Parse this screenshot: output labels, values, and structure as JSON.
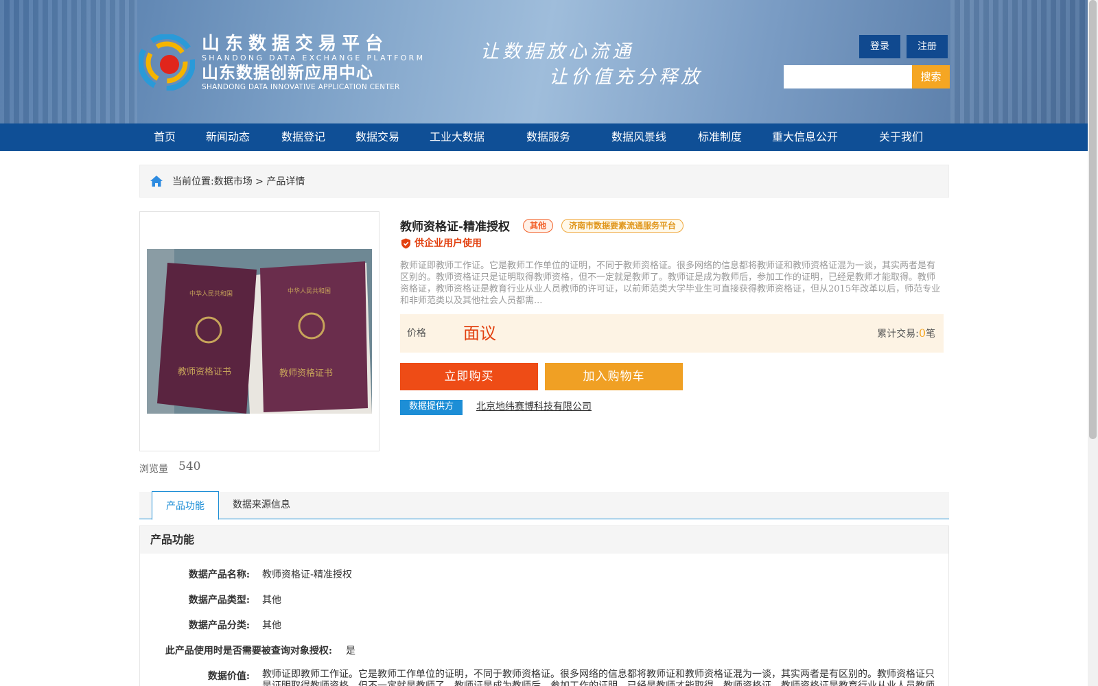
{
  "header": {
    "logo_cn_1": "山东数据交易平台",
    "logo_en_1": "SHANDONG DATA EXCHANGE PLATFORM",
    "logo_cn_2": "山东数据创新应用中心",
    "logo_en_2": "SHANDONG DATA INNOVATIVE APPLICATION CENTER",
    "slogan_1": "让数据放心流通",
    "slogan_2": "让价值充分释放",
    "login_label": "登录",
    "register_label": "注册",
    "search_value": "",
    "search_label": "搜索"
  },
  "nav": {
    "items": [
      "首页",
      "新闻动态",
      "数据登记",
      "数据交易",
      "工业大数据",
      "数据服务",
      "数据风景线",
      "标准制度",
      "重大信息公开",
      "关于我们"
    ]
  },
  "breadcrumb": {
    "prefix": "当前位置:",
    "path": "数据市场 > 产品详情"
  },
  "image": {
    "booklet_emblem_text": "中华人民共和国",
    "booklet_title": "教师资格证书"
  },
  "stats": {
    "views_label": "浏览量",
    "views_value": "540"
  },
  "product": {
    "title": "教师资格证-精准授权",
    "tag_type": "其他",
    "tag_platform": "济南市数据要素流通服务平台",
    "audience": "供企业用户使用",
    "description": "教师证即教师工作证。它是教师工作单位的证明，不同于教师资格证。很多网络的信息都将教师证和教师资格证混为一谈，其实两者是有区别的。教师资格证只是证明取得教师资格，但不一定就是教师了。教师证是成为教师后，参加工作的证明，已经是教师才能取得。教师资格证，教师资格证是教育行业从业人员教师的许可证，以前师范类大学毕业生可直接获得教师资格证，但从2015年改革以后，师范专业和非师范类以及其他社会人员都需...",
    "price_label": "价格",
    "price_value": "面议",
    "trade_prefix": "累计交易:",
    "trade_count": "0",
    "trade_unit": "笔",
    "buy_now_label": "立即购买",
    "add_cart_label": "加入购物车",
    "provider_label": "数据提供方",
    "provider_name": "北京地纬赛博科技有限公司"
  },
  "tabs": {
    "active": "产品功能",
    "other": "数据来源信息"
  },
  "features": {
    "heading": "产品功能",
    "rows": [
      {
        "key": "数据产品名称:",
        "value": "教师资格证-精准授权"
      },
      {
        "key": "数据产品类型:",
        "value": "其他"
      },
      {
        "key": "数据产品分类:",
        "value": "其他"
      },
      {
        "key": "此产品使用时是否需要被查询对象授权:",
        "value": "是"
      },
      {
        "key": "数据价值:",
        "value": "教师证即教师工作证。它是教师工作单位的证明，不同于教师资格证。很多网络的信息都将教师证和教师资格证混为一谈，其实两者是有区别的。教师资格证只是证明取得教师资格，但不一定就是教师了。教师证是成为教师后，参加工作的证明，已经是教师才能取得。教师资格证，教师资格证是教育行业从业人员教师"
      }
    ]
  },
  "colors": {
    "nav_blue": "#0f4f96",
    "accent_orange": "#f5a623",
    "buy_red": "#ee4c16",
    "link_blue": "#1d8ed6"
  }
}
